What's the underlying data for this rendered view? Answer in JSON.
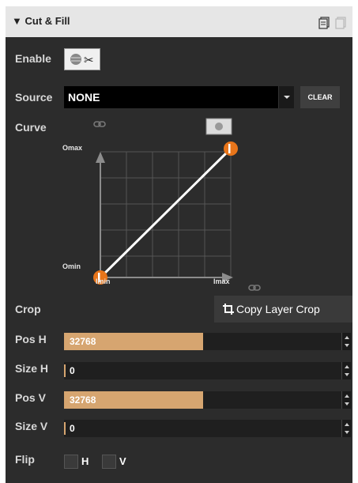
{
  "header": {
    "title": "Cut & Fill",
    "collapse_icon": "triangle-down-icon",
    "actions": [
      "copy-icon",
      "paste-icon"
    ]
  },
  "enable": {
    "label": "Enable",
    "icon": "cut-fill-toggle-icon"
  },
  "source": {
    "label": "Source",
    "value": "NONE",
    "clear_label": "CLEAR"
  },
  "curve": {
    "label": "Curve",
    "y_max_label": "Omax",
    "y_min_label": "Omin",
    "x_min_label": "Imin",
    "x_max_label": "Imax",
    "link_icon": "link-icon",
    "reset_icon": "curve-reset-icon"
  },
  "crop": {
    "label": "Crop",
    "button_label": "Copy Layer Crop",
    "button_icon": "crop-icon"
  },
  "fields": [
    {
      "label": "Pos H",
      "value": "32768",
      "fill": 0.5
    },
    {
      "label": "Size H",
      "value": "0",
      "fill": 0
    },
    {
      "label": "Pos V",
      "value": "32768",
      "fill": 0.5
    },
    {
      "label": "Size V",
      "value": "0",
      "fill": 0
    }
  ],
  "flip": {
    "label": "Flip",
    "h_label": "H",
    "v_label": "V",
    "h_checked": false,
    "v_checked": false
  },
  "colors": {
    "accent": "#d6a570",
    "handle": "#e8751a",
    "panel": "#2c2c2c"
  }
}
